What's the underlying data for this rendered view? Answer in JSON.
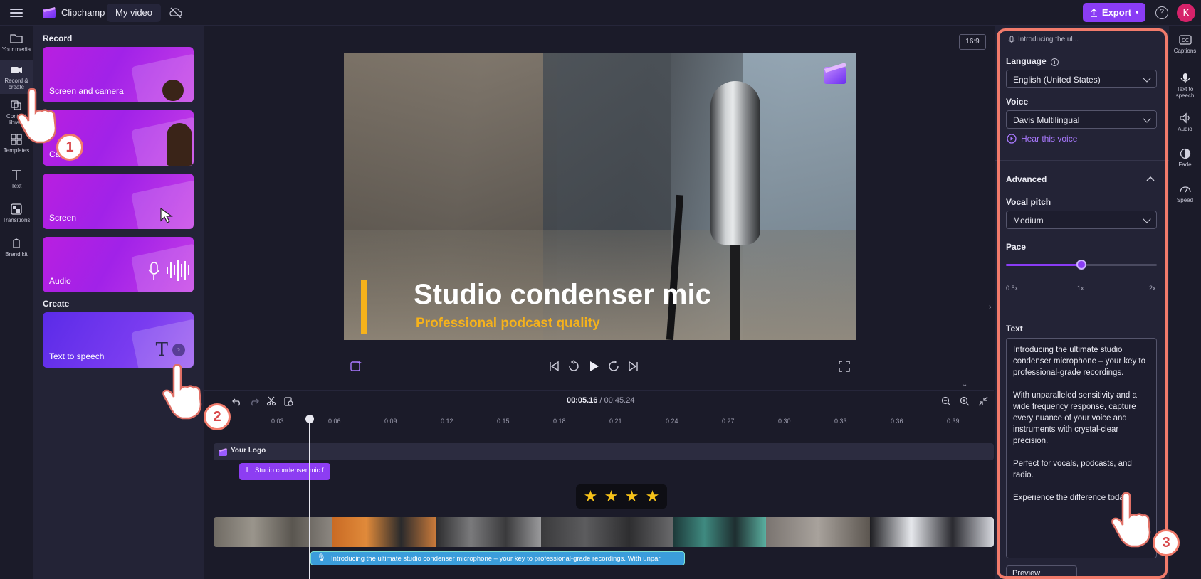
{
  "topbar": {
    "brand": "Clipchamp",
    "project_name": "My video",
    "export_label": "Export",
    "help_label": "?",
    "avatar_initial": "K"
  },
  "left_rail": {
    "items": [
      {
        "label": "Your media",
        "icon": "folder-icon"
      },
      {
        "label": "Record & create",
        "icon": "camera-icon"
      },
      {
        "label": "Content library",
        "icon": "library-icon"
      },
      {
        "label": "Templates",
        "icon": "templates-icon"
      },
      {
        "label": "Text",
        "icon": "text-icon"
      },
      {
        "label": "Transitions",
        "icon": "transitions-icon"
      },
      {
        "label": "Brand kit",
        "icon": "brand-kit-icon"
      }
    ]
  },
  "record_panel": {
    "record_title": "Record",
    "create_title": "Create",
    "cards": [
      {
        "label": "Screen and camera"
      },
      {
        "label": "Ca"
      },
      {
        "label": "Screen"
      },
      {
        "label": "Audio"
      }
    ],
    "create_cards": [
      {
        "label": "Text to speech"
      }
    ]
  },
  "preview": {
    "aspect_ratio": "16:9",
    "headline": "Studio condenser mic",
    "subline": "Professional podcast quality",
    "accent_color": "#f6b21b"
  },
  "timeline": {
    "current_time": "00:05.16",
    "total_time": "/ 00:45.24",
    "ticks": [
      "0:03",
      "0:06",
      "0:09",
      "0:12",
      "0:15",
      "0:18",
      "0:21",
      "0:24",
      "0:27",
      "0:30",
      "0:33",
      "0:36",
      "0:39"
    ],
    "logo_track": "Your Logo",
    "text_track": "Studio condenser mic f",
    "rating_stars": 4,
    "audio_track": "Introducing the ultimate studio condenser microphone – your key to professional-grade recordings. With unpar"
  },
  "tts_panel": {
    "header": "Introducing the ul...",
    "language_label": "Language",
    "language_value": "English (United States)",
    "voice_label": "Voice",
    "voice_value": "Davis Multilingual",
    "hear_voice": "Hear this voice",
    "advanced_label": "Advanced",
    "pitch_label": "Vocal pitch",
    "pitch_value": "Medium",
    "pace_label": "Pace",
    "pace_value_fraction": 0.5,
    "pace_min": "0.5x",
    "pace_mid": "1x",
    "pace_max": "2x",
    "text_label": "Text",
    "text_paragraphs": [
      "Introducing the ultimate studio condenser microphone – your key to professional-grade recordings.",
      "With unparalleled sensitivity and a wide frequency response, capture every nuance of your voice and instruments with crystal-clear precision.",
      "Perfect for vocals, podcasts, and radio.",
      "Experience the difference today."
    ],
    "preview_label": "Preview"
  },
  "right_rail": {
    "items": [
      {
        "label": "Captions",
        "icon": "captions-icon"
      },
      {
        "label": "Text to speech",
        "icon": "tts-icon"
      },
      {
        "label": "Audio",
        "icon": "audio-icon"
      },
      {
        "label": "Fade",
        "icon": "fade-icon"
      },
      {
        "label": "Speed",
        "icon": "speed-icon"
      }
    ]
  },
  "annotations": [
    "1",
    "2",
    "3"
  ],
  "colors": {
    "accent_purple": "#8a3cf5",
    "highlight_outline": "#f27b6b"
  }
}
